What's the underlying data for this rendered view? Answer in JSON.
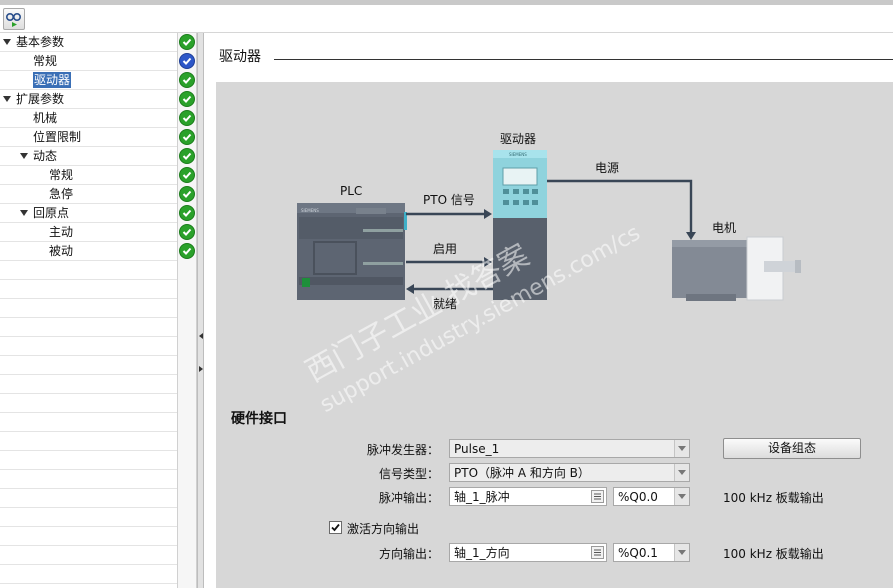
{
  "toolbar": {
    "icon": "view-network-icon"
  },
  "tree": {
    "items": [
      {
        "label": "基本参数",
        "level": 0,
        "expanded": true,
        "status": "ok"
      },
      {
        "label": "常规",
        "level": 1,
        "status": "current"
      },
      {
        "label": "驱动器",
        "level": 1,
        "selected": true,
        "status": "ok"
      },
      {
        "label": "扩展参数",
        "level": 0,
        "expanded": true,
        "status": "ok"
      },
      {
        "label": "机械",
        "level": 1,
        "status": "ok"
      },
      {
        "label": "位置限制",
        "level": 1,
        "status": "ok"
      },
      {
        "label": "动态",
        "level": 1,
        "expanded": true,
        "status": "ok"
      },
      {
        "label": "常规",
        "level": 2,
        "status": "ok"
      },
      {
        "label": "急停",
        "level": 2,
        "status": "ok"
      },
      {
        "label": "回原点",
        "level": 1,
        "expanded": true,
        "status": "ok"
      },
      {
        "label": "主动",
        "level": 2,
        "status": "ok"
      },
      {
        "label": "被动",
        "level": 2,
        "status": "ok"
      }
    ]
  },
  "section": {
    "title": "驱动器"
  },
  "diagram": {
    "plc_label": "PLC",
    "drive_label": "驱动器",
    "motor_label": "电机",
    "power_label": "电源",
    "pto_signal_label": "PTO 信号",
    "enable_label": "启用",
    "ready_label": "就绪",
    "plc_brand": "SIEMENS",
    "drive_brand": "SIEMENS",
    "watermark_line1": "西门子工业 找答案",
    "watermark_line2": "support.industry.siemens.com/cs"
  },
  "hardware": {
    "heading": "硬件接口",
    "pulse_generator_label": "脉冲发生器：",
    "pulse_generator_value": "Pulse_1",
    "config_button": "设备组态",
    "signal_type_label": "信号类型：",
    "signal_type_value": "PTO（脉冲 A 和方向 B）",
    "pulse_output_label": "脉冲输出：",
    "pulse_output_tag": "轴_1_脉冲",
    "pulse_output_address": "%Q0.0",
    "pulse_output_note": "100 kHz 板载输出",
    "direction_checkbox_label": "激活方向输出",
    "direction_checked": true,
    "direction_output_label": "方向输出：",
    "direction_output_tag": "轴_1_方向",
    "direction_output_address": "%Q0.1",
    "direction_output_note": "100 kHz 板载输出"
  },
  "colors": {
    "status_ok": "#2aa12a",
    "status_current": "#2d57c8",
    "selection": "#3a6fb6",
    "panel_bg": "#d7d7d7",
    "drive_teal": "#8fd3dd",
    "device_grey": "#5a6370"
  }
}
